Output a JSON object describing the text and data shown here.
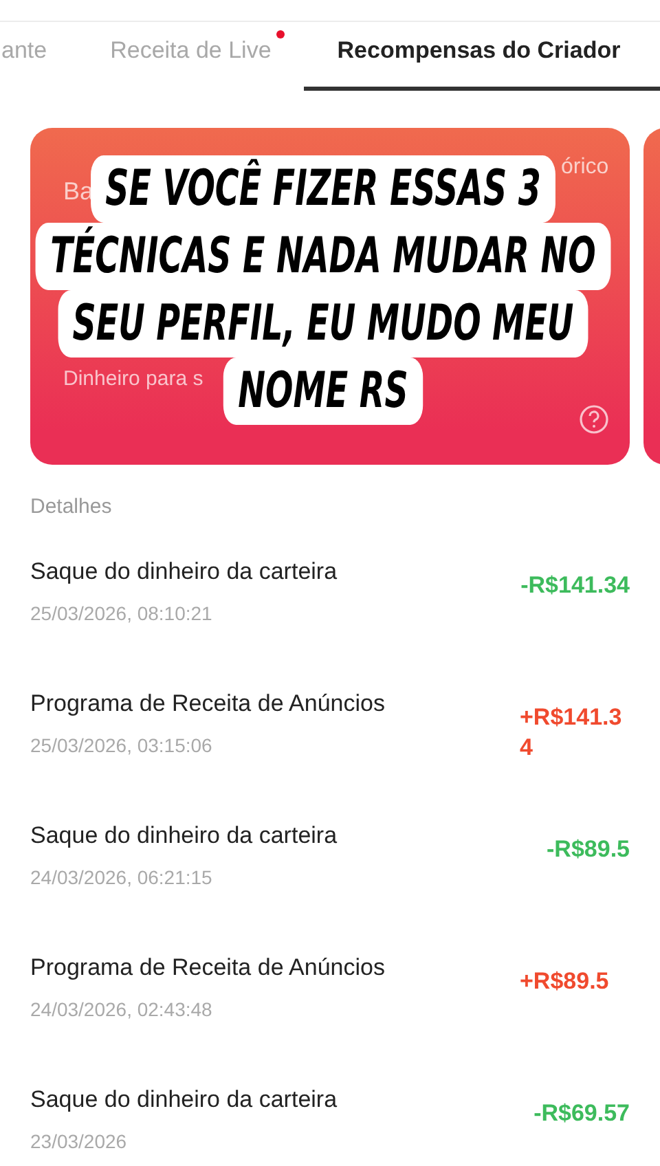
{
  "tabs": [
    {
      "label": "ante",
      "selected": false,
      "dot": false
    },
    {
      "label": "Receita de Live",
      "selected": false,
      "dot": true
    },
    {
      "label": "Recompensas do Criador",
      "selected": true,
      "dot": false
    }
  ],
  "card": {
    "label_top_left": "Ba",
    "history": "órico",
    "footer": "Dinheiro para s"
  },
  "caption_lines": [
    "SE VOCÊ FIZER ESSAS 3",
    "TÉCNICAS E NADA MUDAR NO",
    "SEU PERFIL, EU MUDO MEU",
    "NOME RS"
  ],
  "details_title": "Detalhes",
  "transactions": [
    {
      "title": "Saque do dinheiro da carteira",
      "date": "25/03/2026, 08:10:21",
      "amount": "-R$141.34",
      "kind": "debit"
    },
    {
      "title": "Programa de Receita de Anúncios",
      "date": "25/03/2026, 03:15:06",
      "amount": "+R$141.34",
      "kind": "credit"
    },
    {
      "title": "Saque do dinheiro da carteira",
      "date": "24/03/2026, 06:21:15",
      "amount": "-R$89.5",
      "kind": "debit"
    },
    {
      "title": "Programa de Receita de Anúncios",
      "date": "24/03/2026, 02:43:48",
      "amount": "+R$89.5",
      "kind": "credit"
    },
    {
      "title": "Saque do dinheiro da carteira",
      "date": "23/03/2026",
      "amount": "-R$69.57",
      "kind": "debit"
    }
  ]
}
